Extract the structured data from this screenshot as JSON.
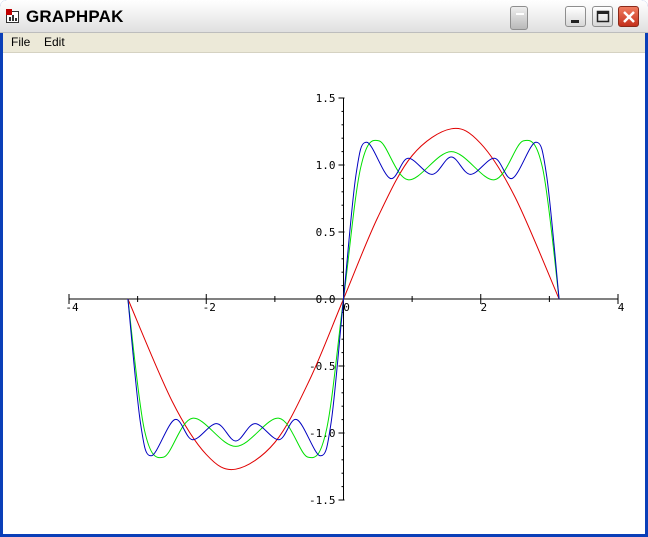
{
  "window": {
    "title": "GRAPHPAK",
    "icon": "app-icon",
    "buttons": [
      "extra-button",
      "minimize-icon",
      "maximize-icon",
      "close-icon"
    ]
  },
  "menubar": {
    "file": "File",
    "edit": "Edit"
  },
  "colors": {
    "series_red": "#e00000",
    "series_green": "#00e000",
    "series_blue": "#0000c0",
    "axis": "#000000",
    "close_button": "#c4301c"
  },
  "chart_data": {
    "type": "line",
    "title": "",
    "xlabel": "",
    "ylabel": "",
    "xlim": [
      -4,
      4
    ],
    "ylim": [
      -1.5,
      1.5
    ],
    "grid": false,
    "x_tick_labels": [
      "-4",
      "-2",
      "0",
      "2",
      "4"
    ],
    "y_tick_labels": [
      "1.5",
      "1.0",
      "0.5",
      "0.0",
      "-0.5",
      "-1.0",
      "-1.5"
    ],
    "x_ticks": [
      -4,
      -2,
      0,
      2,
      4
    ],
    "y_ticks": [
      1.5,
      1.0,
      0.5,
      0.0,
      -0.5,
      -1.0,
      -1.5
    ],
    "domain": [
      -3.1416,
      3.1416
    ],
    "series": [
      {
        "color": "#e00000",
        "x": [
          -3.1416,
          -2.5,
          -2.0,
          -1.5708,
          -1.0,
          -0.5,
          0.0,
          0.5,
          1.0,
          1.5708,
          2.0,
          2.5,
          3.1416
        ],
        "y": [
          0.0,
          -0.76,
          -1.16,
          -1.27,
          -1.07,
          -0.61,
          0.0,
          0.61,
          1.07,
          1.27,
          1.16,
          0.76,
          0.0
        ]
      },
      {
        "color": "#00e000",
        "x": [
          -3.1416,
          -2.9,
          -2.62,
          -2.2,
          -1.5708,
          -0.94,
          -0.52,
          -0.25,
          0.0,
          0.25,
          0.52,
          0.94,
          1.5708,
          2.2,
          2.62,
          2.9,
          3.1416
        ],
        "y": [
          0.0,
          -0.98,
          -1.18,
          -0.89,
          -1.1,
          -0.89,
          -1.18,
          -0.98,
          0.0,
          0.98,
          1.18,
          0.89,
          1.1,
          0.89,
          1.18,
          0.98,
          0.0
        ]
      },
      {
        "color": "#0000c0",
        "x": [
          -3.1416,
          -2.96,
          -2.8,
          -2.46,
          -2.2,
          -1.85,
          -1.5708,
          -1.29,
          -0.94,
          -0.68,
          -0.34,
          -0.18,
          0.0,
          0.18,
          0.34,
          0.68,
          0.94,
          1.29,
          1.5708,
          1.85,
          2.2,
          2.46,
          2.8,
          2.96,
          3.1416
        ],
        "y": [
          0.0,
          -0.92,
          -1.17,
          -0.9,
          -1.05,
          -0.93,
          -1.06,
          -0.93,
          -1.05,
          -0.9,
          -1.17,
          -0.92,
          0.0,
          0.92,
          1.17,
          0.9,
          1.05,
          0.93,
          1.06,
          0.93,
          1.05,
          0.9,
          1.17,
          0.92,
          0.0
        ]
      }
    ]
  }
}
